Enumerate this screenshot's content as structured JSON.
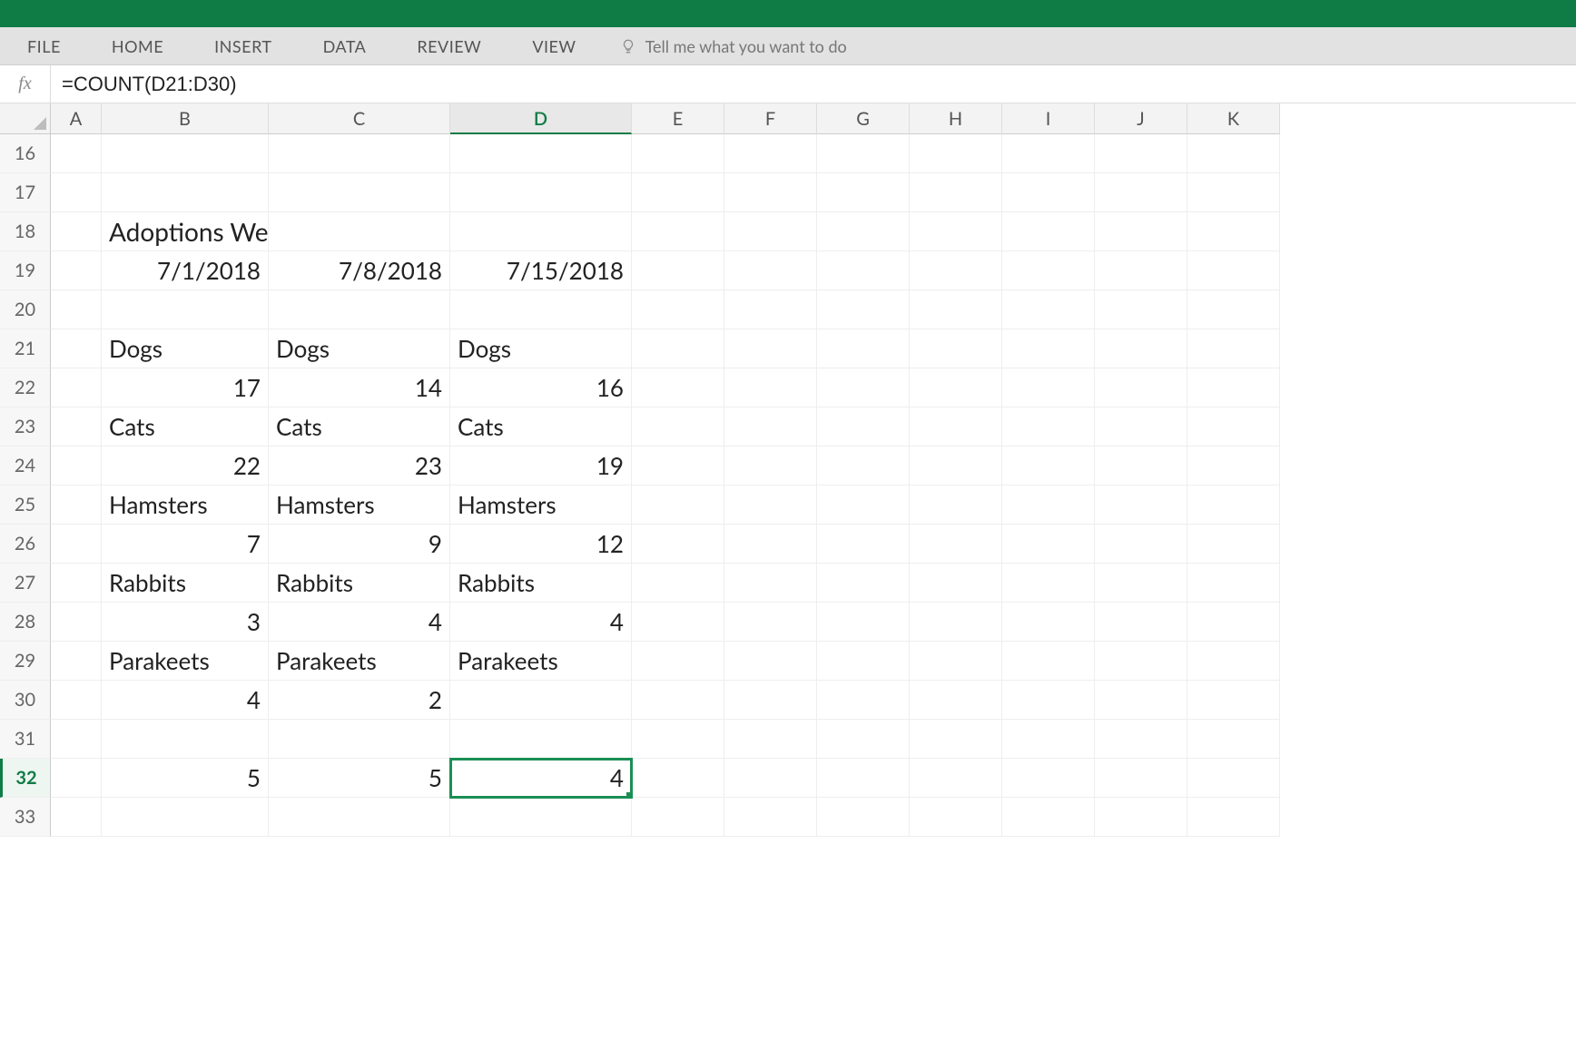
{
  "ribbon": {
    "tabs": [
      "FILE",
      "HOME",
      "INSERT",
      "DATA",
      "REVIEW",
      "VIEW"
    ],
    "tellme_placeholder": "Tell me what you want to do"
  },
  "formula_bar": {
    "fx_label": "fx",
    "content": "=COUNT(D21:D30)"
  },
  "columns": [
    "A",
    "B",
    "C",
    "D",
    "E",
    "F",
    "G",
    "H",
    "I",
    "J",
    "K"
  ],
  "selected_column": "D",
  "selected_row": "32",
  "selected_cell": "D32",
  "rows": [
    {
      "n": "16",
      "cells": {
        "A": "",
        "B": "",
        "C": "",
        "D": "",
        "E": "",
        "F": "",
        "G": "",
        "H": "",
        "I": "",
        "J": "",
        "K": ""
      }
    },
    {
      "n": "17",
      "cells": {
        "A": "",
        "B": "",
        "C": "",
        "D": "",
        "E": "",
        "F": "",
        "G": "",
        "H": "",
        "I": "",
        "J": "",
        "K": ""
      }
    },
    {
      "n": "18",
      "cells": {
        "A": "",
        "B": "Adoptions Week of…",
        "C": "",
        "D": "",
        "E": "",
        "F": "",
        "G": "",
        "H": "",
        "I": "",
        "J": "",
        "K": ""
      },
      "align": {
        "B": "l"
      }
    },
    {
      "n": "19",
      "cells": {
        "A": "",
        "B": "7/1/2018",
        "C": "7/8/2018",
        "D": "7/15/2018",
        "E": "",
        "F": "",
        "G": "",
        "H": "",
        "I": "",
        "J": "",
        "K": ""
      },
      "align": {
        "B": "r",
        "C": "r",
        "D": "r"
      }
    },
    {
      "n": "20",
      "cells": {
        "A": "",
        "B": "",
        "C": "",
        "D": "",
        "E": "",
        "F": "",
        "G": "",
        "H": "",
        "I": "",
        "J": "",
        "K": ""
      }
    },
    {
      "n": "21",
      "cells": {
        "A": "",
        "B": "Dogs",
        "C": "Dogs",
        "D": "Dogs",
        "E": "",
        "F": "",
        "G": "",
        "H": "",
        "I": "",
        "J": "",
        "K": ""
      },
      "align": {
        "B": "l",
        "C": "l",
        "D": "l"
      }
    },
    {
      "n": "22",
      "cells": {
        "A": "",
        "B": "17",
        "C": "14",
        "D": "16",
        "E": "",
        "F": "",
        "G": "",
        "H": "",
        "I": "",
        "J": "",
        "K": ""
      },
      "align": {
        "B": "r",
        "C": "r",
        "D": "r"
      }
    },
    {
      "n": "23",
      "cells": {
        "A": "",
        "B": "Cats",
        "C": "Cats",
        "D": "Cats",
        "E": "",
        "F": "",
        "G": "",
        "H": "",
        "I": "",
        "J": "",
        "K": ""
      },
      "align": {
        "B": "l",
        "C": "l",
        "D": "l"
      }
    },
    {
      "n": "24",
      "cells": {
        "A": "",
        "B": "22",
        "C": "23",
        "D": "19",
        "E": "",
        "F": "",
        "G": "",
        "H": "",
        "I": "",
        "J": "",
        "K": ""
      },
      "align": {
        "B": "r",
        "C": "r",
        "D": "r"
      }
    },
    {
      "n": "25",
      "cells": {
        "A": "",
        "B": "Hamsters",
        "C": "Hamsters",
        "D": "Hamsters",
        "E": "",
        "F": "",
        "G": "",
        "H": "",
        "I": "",
        "J": "",
        "K": ""
      },
      "align": {
        "B": "l",
        "C": "l",
        "D": "l"
      }
    },
    {
      "n": "26",
      "cells": {
        "A": "",
        "B": "7",
        "C": "9",
        "D": "12",
        "E": "",
        "F": "",
        "G": "",
        "H": "",
        "I": "",
        "J": "",
        "K": ""
      },
      "align": {
        "B": "r",
        "C": "r",
        "D": "r"
      }
    },
    {
      "n": "27",
      "cells": {
        "A": "",
        "B": "Rabbits",
        "C": "Rabbits",
        "D": "Rabbits",
        "E": "",
        "F": "",
        "G": "",
        "H": "",
        "I": "",
        "J": "",
        "K": ""
      },
      "align": {
        "B": "l",
        "C": "l",
        "D": "l"
      }
    },
    {
      "n": "28",
      "cells": {
        "A": "",
        "B": "3",
        "C": "4",
        "D": "4",
        "E": "",
        "F": "",
        "G": "",
        "H": "",
        "I": "",
        "J": "",
        "K": ""
      },
      "align": {
        "B": "r",
        "C": "r",
        "D": "r"
      }
    },
    {
      "n": "29",
      "cells": {
        "A": "",
        "B": "Parakeets",
        "C": "Parakeets",
        "D": "Parakeets",
        "E": "",
        "F": "",
        "G": "",
        "H": "",
        "I": "",
        "J": "",
        "K": ""
      },
      "align": {
        "B": "l",
        "C": "l",
        "D": "l"
      }
    },
    {
      "n": "30",
      "cells": {
        "A": "",
        "B": "4",
        "C": "2",
        "D": "",
        "E": "",
        "F": "",
        "G": "",
        "H": "",
        "I": "",
        "J": "",
        "K": ""
      },
      "align": {
        "B": "r",
        "C": "r"
      }
    },
    {
      "n": "31",
      "cells": {
        "A": "",
        "B": "",
        "C": "",
        "D": "",
        "E": "",
        "F": "",
        "G": "",
        "H": "",
        "I": "",
        "J": "",
        "K": ""
      }
    },
    {
      "n": "32",
      "cells": {
        "A": "",
        "B": "5",
        "C": "5",
        "D": "4",
        "E": "",
        "F": "",
        "G": "",
        "H": "",
        "I": "",
        "J": "",
        "K": ""
      },
      "align": {
        "B": "r",
        "C": "r",
        "D": "r"
      }
    },
    {
      "n": "33",
      "cells": {
        "A": "",
        "B": "",
        "C": "",
        "D": "",
        "E": "",
        "F": "",
        "G": "",
        "H": "",
        "I": "",
        "J": "",
        "K": ""
      }
    }
  ],
  "chart_data": {
    "type": "table",
    "title": "Adoptions Week of…",
    "columns": [
      "7/1/2018",
      "7/8/2018",
      "7/15/2018"
    ],
    "rows": [
      {
        "label": "Dogs",
        "values": [
          17,
          14,
          16
        ]
      },
      {
        "label": "Cats",
        "values": [
          22,
          23,
          19
        ]
      },
      {
        "label": "Hamsters",
        "values": [
          7,
          9,
          12
        ]
      },
      {
        "label": "Rabbits",
        "values": [
          3,
          4,
          4
        ]
      },
      {
        "label": "Parakeets",
        "values": [
          4,
          2,
          null
        ]
      }
    ],
    "count_row": {
      "formula": "=COUNT(col21:col30)",
      "values": [
        5,
        5,
        4
      ]
    }
  }
}
